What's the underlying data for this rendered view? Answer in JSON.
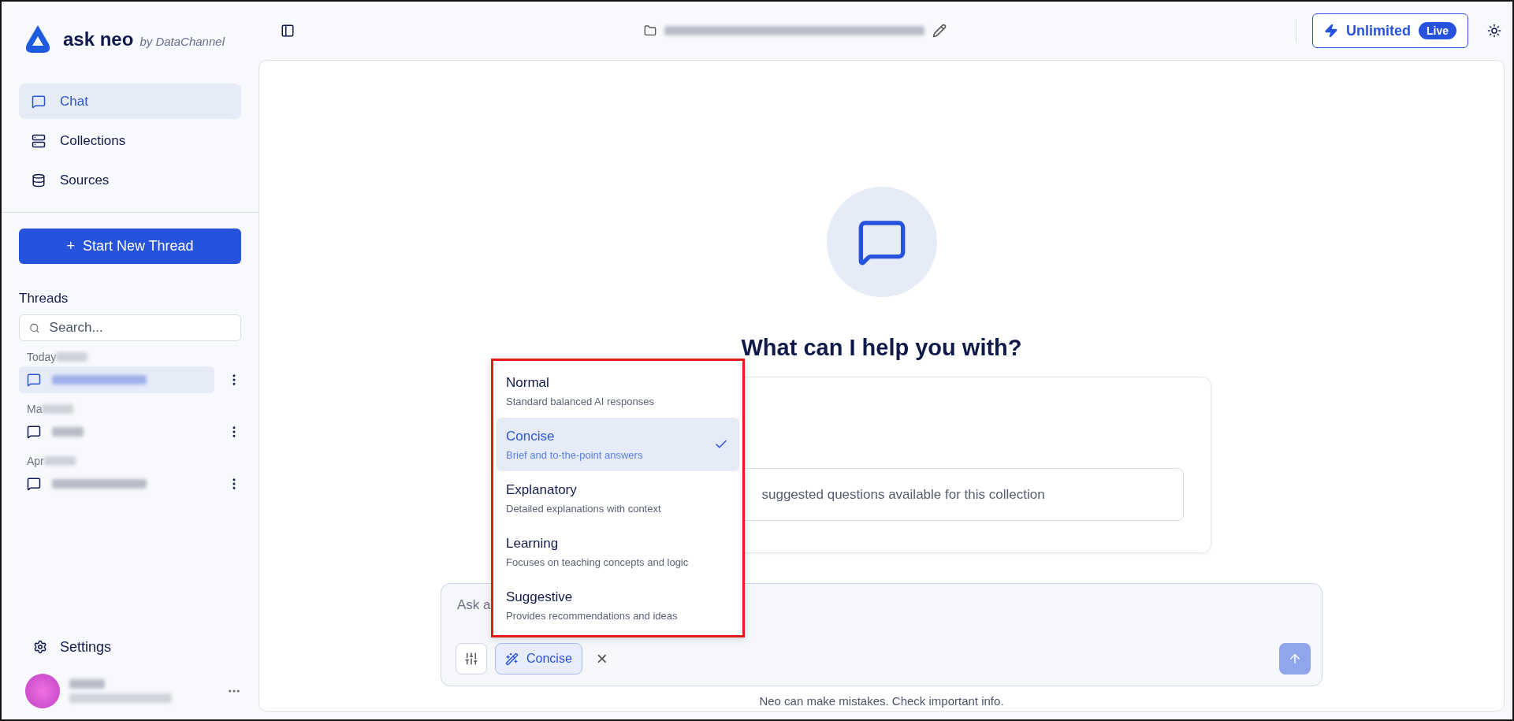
{
  "brand": {
    "name": "ask neo",
    "byline": "by DataChannel"
  },
  "nav": [
    {
      "label": "Chat",
      "selected": true
    },
    {
      "label": "Collections",
      "selected": false
    },
    {
      "label": "Sources",
      "selected": false
    }
  ],
  "new_thread_button": {
    "icon": "+",
    "label": "Start New Thread"
  },
  "threads": {
    "title": "Threads",
    "search": {
      "placeholder": "Search..."
    },
    "groups": [
      {
        "label": "Today",
        "items": [
          {
            "selected": true
          }
        ]
      },
      {
        "label": "Ma",
        "items": [
          {
            "selected": false
          }
        ]
      },
      {
        "label": "Apr",
        "items": [
          {
            "selected": false
          }
        ]
      }
    ]
  },
  "settings": {
    "label": "Settings"
  },
  "plan_button": {
    "label": "Unlimited",
    "badge": "Live"
  },
  "empty_state": {
    "heading": "What can I help you with?",
    "suggestion": "suggested questions available for this collection"
  },
  "composer": {
    "placeholder": "Ask a",
    "mode_chip": "Concise",
    "clear": "×"
  },
  "mode_menu": [
    {
      "label": "Normal",
      "description": "Standard balanced AI responses",
      "selected": false
    },
    {
      "label": "Concise",
      "description": "Brief and to-the-point answers",
      "selected": true
    },
    {
      "label": "Explanatory",
      "description": "Detailed explanations with context",
      "selected": false
    },
    {
      "label": "Learning",
      "description": "Focuses on teaching concepts and logic",
      "selected": false
    },
    {
      "label": "Suggestive",
      "description": "Provides recommendations and ideas",
      "selected": false
    }
  ],
  "footer_note": "Neo can make mistakes. Check important info."
}
